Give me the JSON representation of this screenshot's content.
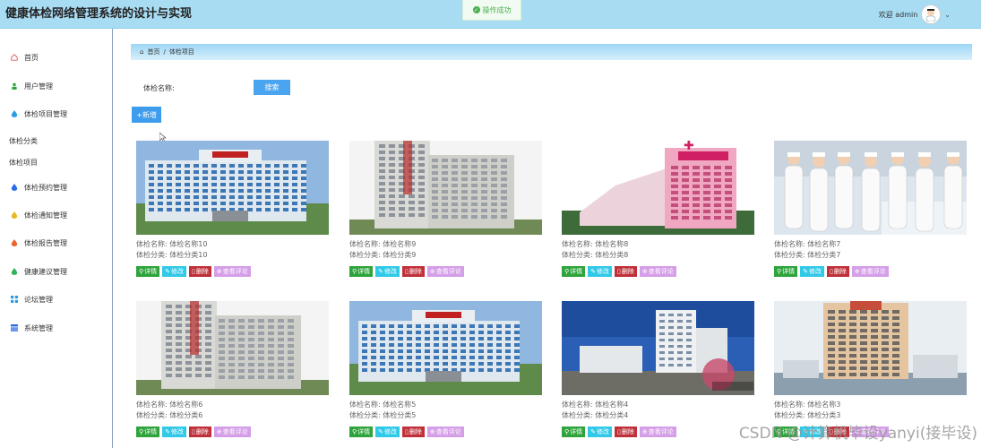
{
  "header": {
    "title": "健康体检网络管理系统的设计与实现",
    "toast": "操作成功",
    "welcome": "欢迎 admin"
  },
  "sidebar": {
    "items": [
      {
        "label": "首页",
        "icon": "home-icon",
        "color": "#e06060"
      },
      {
        "label": "用户管理",
        "icon": "user-icon",
        "color": "#2fa43c"
      },
      {
        "label": "体检项目管理",
        "icon": "drop-icon",
        "color": "#2b9be6"
      },
      {
        "label": "体检分类",
        "icon": "",
        "color": ""
      },
      {
        "label": "体检项目",
        "icon": "",
        "color": ""
      },
      {
        "label": "体检预约管理",
        "icon": "drop-icon",
        "color": "#2b6be6"
      },
      {
        "label": "体检通知管理",
        "icon": "drop-icon",
        "color": "#e8b820"
      },
      {
        "label": "体检报告管理",
        "icon": "drop-icon",
        "color": "#e8642a"
      },
      {
        "label": "健康建议管理",
        "icon": "drop-icon",
        "color": "#2fb35a"
      },
      {
        "label": "论坛管理",
        "icon": "grid-icon",
        "color": "#2b9be6"
      },
      {
        "label": "系统管理",
        "icon": "table-icon",
        "color": "#2b6be6"
      }
    ]
  },
  "breadcrumb": {
    "home": "首页",
    "sep": "/",
    "current": "体检项目"
  },
  "search": {
    "label": "体检名称:",
    "value": "",
    "placeholder": "",
    "button": "搜索"
  },
  "add_button": "+新增",
  "field_labels": {
    "name": "体检名称:",
    "category": "体检分类:"
  },
  "actions": {
    "detail": "详情",
    "edit": "修改",
    "delete": "删除",
    "review": "查看评论"
  },
  "cards": [
    {
      "name": "体检名称10",
      "category": "体检分类10",
      "image": "hospital-blue-building"
    },
    {
      "name": "体检名称9",
      "category": "体检分类9",
      "image": "hospital-gray-tower"
    },
    {
      "name": "体检名称8",
      "category": "体检分类8",
      "image": "hospital-pink-building"
    },
    {
      "name": "体检名称7",
      "category": "体检分类7",
      "image": "nurses-ward"
    },
    {
      "name": "体检名称6",
      "category": "体检分类6",
      "image": "hospital-gray-tower"
    },
    {
      "name": "体检名称5",
      "category": "体检分类5",
      "image": "hospital-blue-building"
    },
    {
      "name": "体检名称4",
      "category": "体检分类4",
      "image": "hospital-campus-sky"
    },
    {
      "name": "体检名称3",
      "category": "体检分类3",
      "image": "hospital-beige-tower"
    }
  ],
  "watermark": "CSDN @计算机毕设yanyi(接毕设)"
}
